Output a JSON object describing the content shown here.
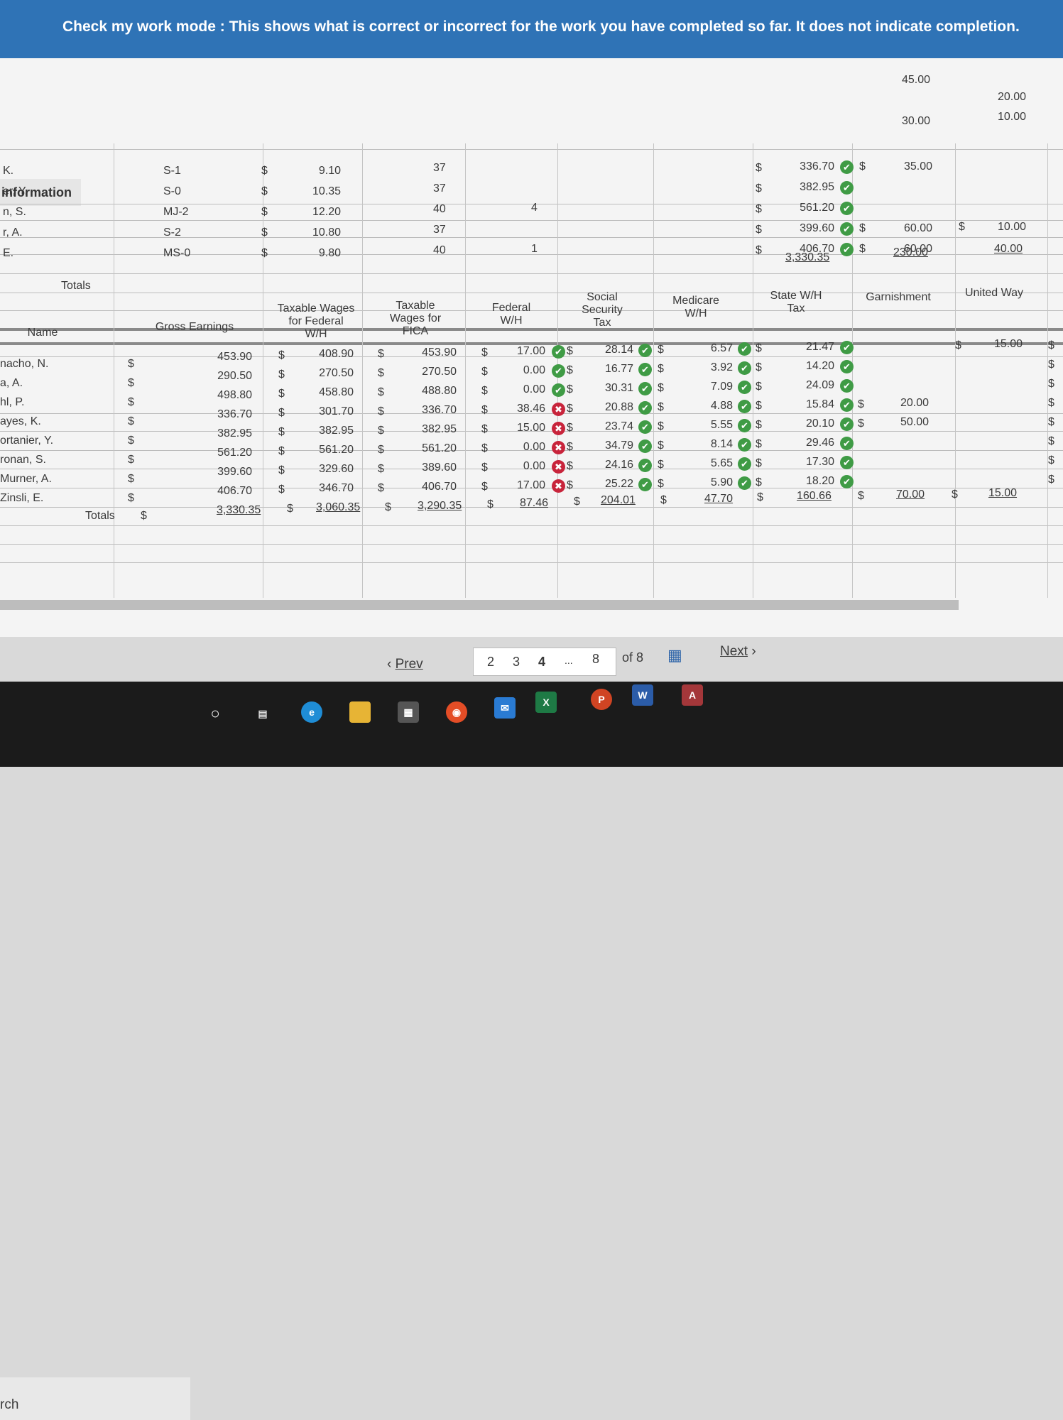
{
  "banner": {
    "text": "Check my work mode : This shows what is correct or incorrect for the work you have completed so far. It does not indicate completion."
  },
  "info_tab": "information",
  "top_rows": [
    {
      "name": "K.",
      "status": "S-1",
      "rate": "9.10",
      "hours": "37",
      "fed": "",
      "total": "336.70",
      "g": "35.00",
      "uw": ""
    },
    {
      "name": "er, Y.",
      "status": "S-0",
      "rate": "10.35",
      "hours": "37",
      "fed": "",
      "total": "382.95",
      "g": "",
      "uw": ""
    },
    {
      "name": "n, S.",
      "status": "MJ-2",
      "rate": "12.20",
      "hours": "40",
      "fed": "4",
      "total": "561.20",
      "g": "",
      "uw": ""
    },
    {
      "name": "r, A.",
      "status": "S-2",
      "rate": "10.80",
      "hours": "37",
      "fed": "",
      "total": "399.60",
      "g": "60.00",
      "uw": "10.00"
    },
    {
      "name": "E.",
      "status": "MS-0",
      "rate": "9.80",
      "hours": "40",
      "fed": "1",
      "total": "406.70",
      "g": "60.00",
      "uw": ""
    }
  ],
  "top_extra": {
    "g1": "45.00",
    "g2": "30.00",
    "uw1": "20.00",
    "uw2": "10.00",
    "total_gross": "3,330.35",
    "total_g": "230.00",
    "total_uw": "40.00",
    "totals_label": "Totals"
  },
  "headers": {
    "name": "Name",
    "gross": "Gross Earnings",
    "taxable_fed": "Taxable Wages for Federal W/H",
    "taxable_fica": "Taxable Wages for FICA",
    "fed_wh": "Federal W/H",
    "ss": "Social Security Tax",
    "medicare": "Medicare W/H",
    "state": "State W/H Tax",
    "garnish": "Garnishment",
    "united": "United Way"
  },
  "rows": [
    {
      "name": "nacho, N.",
      "gross": "453.90",
      "tfed": "408.90",
      "tfica": "453.90",
      "fed": "17.00",
      "fed_ok": true,
      "ss": "28.14",
      "med": "6.57",
      "state": "21.47",
      "garn": "",
      "uw": "15.00"
    },
    {
      "name": "a, A.",
      "gross": "290.50",
      "tfed": "270.50",
      "tfica": "270.50",
      "fed": "0.00",
      "fed_ok": true,
      "ss": "16.77",
      "med": "3.92",
      "state": "14.20",
      "garn": "",
      "uw": ""
    },
    {
      "name": "hl, P.",
      "gross": "498.80",
      "tfed": "458.80",
      "tfica": "488.80",
      "fed": "0.00",
      "fed_ok": true,
      "ss": "30.31",
      "med": "7.09",
      "state": "24.09",
      "garn": "",
      "uw": ""
    },
    {
      "name": "ayes, K.",
      "gross": "336.70",
      "tfed": "301.70",
      "tfica": "336.70",
      "fed": "38.46",
      "fed_ok": false,
      "ss": "20.88",
      "med": "4.88",
      "state": "15.84",
      "garn": "20.00",
      "uw": ""
    },
    {
      "name": "ortanier, Y.",
      "gross": "382.95",
      "tfed": "382.95",
      "tfica": "382.95",
      "fed": "15.00",
      "fed_ok": false,
      "ss": "23.74",
      "med": "5.55",
      "state": "20.10",
      "garn": "50.00",
      "uw": ""
    },
    {
      "name": "ronan, S.",
      "gross": "561.20",
      "tfed": "561.20",
      "tfica": "561.20",
      "fed": "0.00",
      "fed_ok": false,
      "ss": "34.79",
      "med": "8.14",
      "state": "29.46",
      "garn": "",
      "uw": ""
    },
    {
      "name": "Murner, A.",
      "gross": "399.60",
      "tfed": "329.60",
      "tfica": "389.60",
      "fed": "0.00",
      "fed_ok": false,
      "ss": "24.16",
      "med": "5.65",
      "state": "17.30",
      "garn": "",
      "uw": ""
    },
    {
      "name": "Zinsli, E.",
      "gross": "406.70",
      "tfed": "346.70",
      "tfica": "406.70",
      "fed": "17.00",
      "fed_ok": false,
      "ss": "25.22",
      "med": "5.90",
      "state": "18.20",
      "garn": "",
      "uw": ""
    }
  ],
  "totals": {
    "label": "Totals",
    "gross": "3,330.35",
    "tfed": "3,060.35",
    "tfica": "3,290.35",
    "fed": "87.46",
    "ss": "204.01",
    "med": "47.70",
    "state": "160.66",
    "garn": "70.00",
    "uw": "15.00"
  },
  "currency": "$",
  "pager": {
    "prev": "Prev",
    "pages": [
      "2",
      "3",
      "4",
      "...",
      "8"
    ],
    "of": "of 8",
    "next": "Next"
  },
  "taskbar": {
    "search": "rch"
  }
}
